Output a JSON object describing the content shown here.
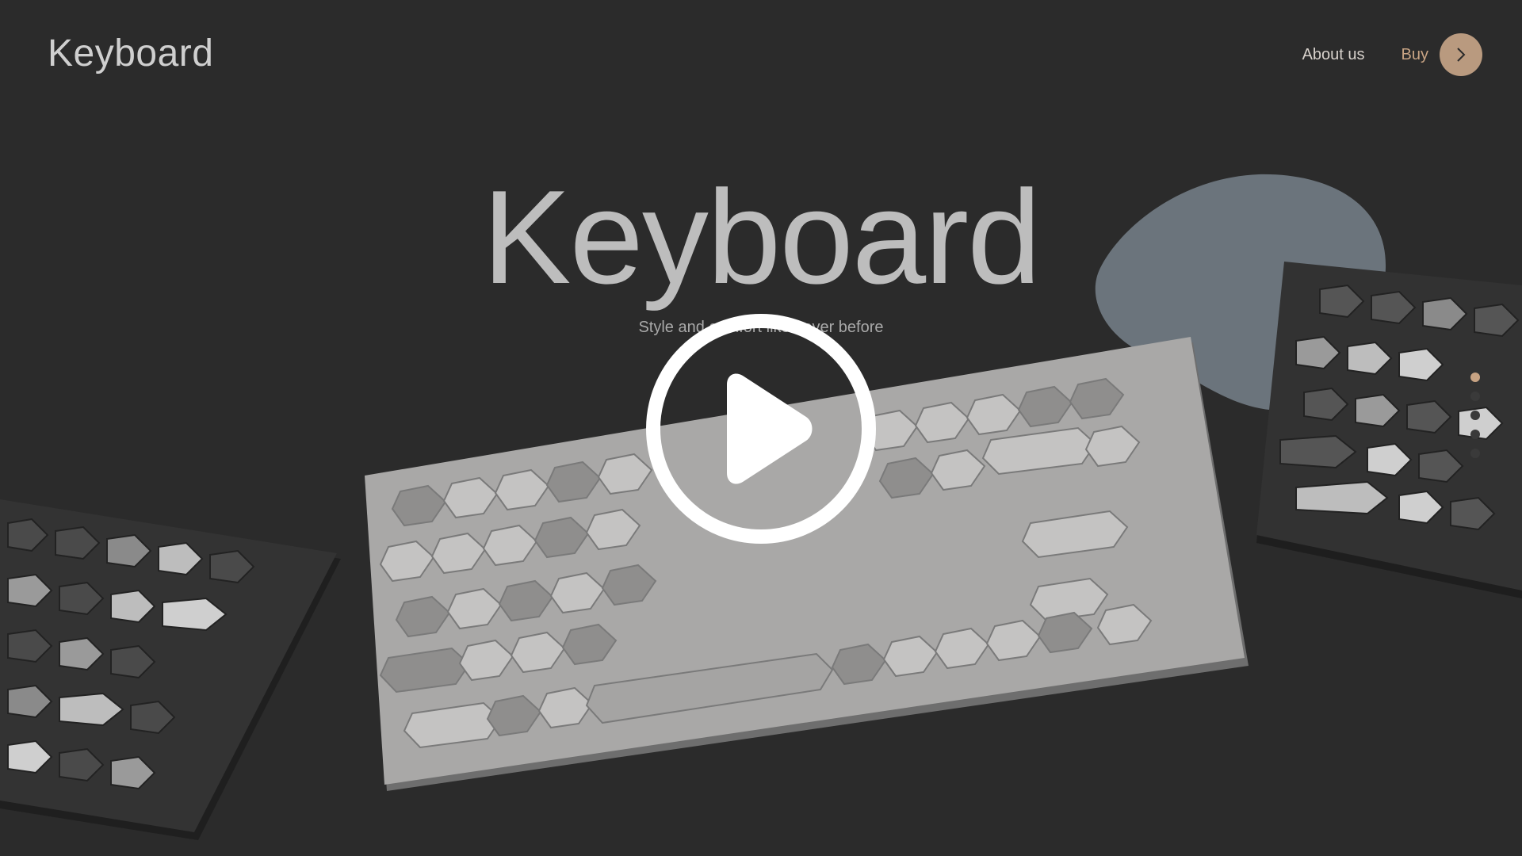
{
  "header": {
    "logo": "Keyboard",
    "nav": {
      "about_label": "About us",
      "buy_label": "Buy"
    }
  },
  "hero": {
    "title": "Keyboard",
    "subtitle": "Style and comfort like never before"
  },
  "carousel": {
    "slide_count": 5,
    "active_index": 0
  },
  "colors": {
    "background": "#2b2b2b",
    "accent": "#c7a383",
    "blob": "#6b747c"
  },
  "icons": {
    "buy": "chevron-right-icon",
    "play": "play-icon"
  }
}
